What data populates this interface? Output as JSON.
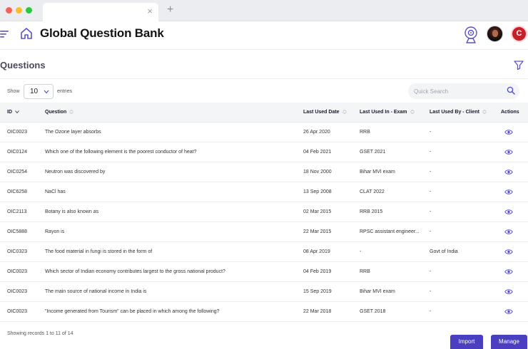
{
  "browser": {
    "tab_close": "×",
    "new_tab": "+"
  },
  "header": {
    "title": "Global Question Bank",
    "brand_letter": "C"
  },
  "section": {
    "title": "Questions"
  },
  "controls": {
    "show_label": "Show",
    "entries_value": "10",
    "entries_label": "entries",
    "search_placeholder": "Quick Search"
  },
  "table": {
    "columns": [
      "ID",
      "Question",
      "Last Used Date",
      "Last Used In - Exam",
      "Last Used By - Client",
      "Actions"
    ],
    "rows": [
      {
        "id": "OIC0023",
        "question": "The Ozone layer absorbs",
        "date": "26 Apr 2020",
        "exam": "RRB",
        "client": "-"
      },
      {
        "id": "OIC0124",
        "question": "Which one of the following element is the poorest conductor of heat?",
        "date": "04 Feb 2021",
        "exam": "GSET 2021",
        "client": "-"
      },
      {
        "id": "OIC0254",
        "question": "Neutron was discovered by",
        "date": "18 Nov 2000",
        "exam": "Bihar MVI exam",
        "client": "-"
      },
      {
        "id": "OIC6258",
        "question": "NaCl has",
        "date": "13 Sep 2008",
        "exam": "CLAT 2022",
        "client": "-"
      },
      {
        "id": "OIC2113",
        "question": "Botany is also known as",
        "date": "02 Mar 2015",
        "exam": "RRB 2015",
        "client": "-"
      },
      {
        "id": "OIC5888",
        "question": "Rayon is",
        "date": "22 Mar 2015",
        "exam": "RPSC assistant engineer...",
        "client": "-"
      },
      {
        "id": "OIC0323",
        "question": "The food material in fungi is stored in the form of",
        "date": "08 Apr 2019",
        "exam": "-",
        "client": "Govt of India"
      },
      {
        "id": "OIC0023",
        "question": "Which sector of Indian economy contributes largest to the gross national product?",
        "date": "04 Feb 2019",
        "exam": "RRB",
        "client": "-"
      },
      {
        "id": "OIC0023",
        "question": "The main source of national income in India is",
        "date": "15 Sep 2019",
        "exam": "Bihar MVI exam",
        "client": "-"
      },
      {
        "id": "OIC0023",
        "question": "\"Income generated from Tourism\" can be placed in which among the following?",
        "date": "22 Mar 2018",
        "exam": "GSET 2018",
        "client": "-"
      }
    ]
  },
  "footer": {
    "info": "Showing records 1 to 11 of 14",
    "import_label": "Import",
    "manage_label": "Manage"
  },
  "colors": {
    "accent": "#4a3fbf",
    "icon": "#5a52c7",
    "brand": "#c8202a"
  }
}
